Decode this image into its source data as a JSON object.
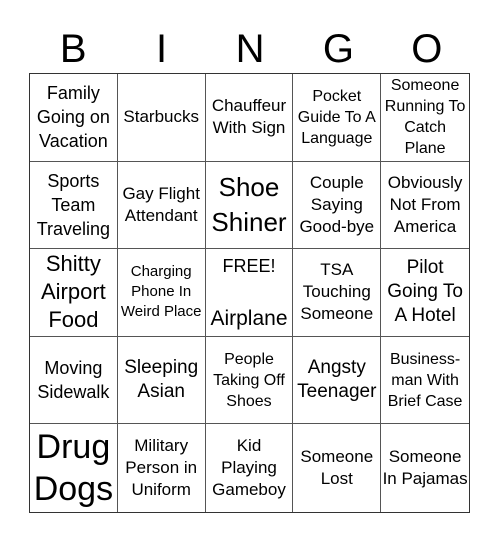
{
  "header": {
    "letters": [
      "B",
      "I",
      "N",
      "G",
      "O"
    ]
  },
  "grid": {
    "cells": [
      "Family Going on Vacation",
      "Starbucks",
      "Chauffeur With Sign",
      "Pocket Guide To A Language",
      "Someone Running To Catch Plane",
      "Sports Team Traveling",
      "Gay Flight Attendant",
      "Shoe Shiner",
      "Couple Saying Good-bye",
      "Obviously Not From America",
      "Shitty Airport Food",
      "Charging Phone In Weird Place",
      "Airplane",
      "TSA Touching Someone",
      "Pilot Going To A Hotel",
      "Moving Sidewalk",
      "Sleeping Asian",
      "People Taking Off Shoes",
      "Angsty Teenager",
      "Business-man With Brief Case",
      "Drug Dogs",
      "Military Person in Uniform",
      "Kid Playing Gameboy",
      "Someone Lost",
      "Someone In Pajamas"
    ],
    "free_label": "FREE!"
  }
}
